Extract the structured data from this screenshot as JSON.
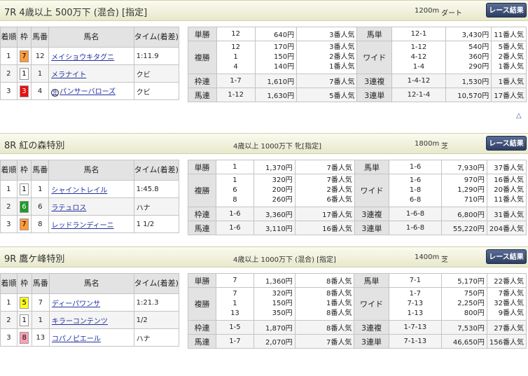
{
  "races": [
    {
      "title": "7R 4歳以上 500万下 (混合) [指定]",
      "cond": "",
      "dist": "1200m",
      "course": "ダート",
      "button": "レース結果",
      "head": {
        "rank": "着順",
        "waku": "枠",
        "uma": "馬番",
        "name": "馬名",
        "time": "タイム(着差)"
      },
      "rows": [
        {
          "rank": "1",
          "waku": "7",
          "waku_bg": "#ff9a3c",
          "waku_fg": "#000",
          "uma": "12",
          "name": "メイショウキタグニ",
          "time": "1:11.9",
          "mark": ""
        },
        {
          "rank": "2",
          "waku": "1",
          "waku_bg": "#ffffff",
          "waku_fg": "#000",
          "uma": "1",
          "name": "メラナイト",
          "time": "クビ",
          "mark": ""
        },
        {
          "rank": "3",
          "waku": "3",
          "waku_bg": "#e81010",
          "waku_fg": "#fff",
          "uma": "4",
          "name": "パンサーバローズ",
          "time": "クビ",
          "mark": "外"
        }
      ],
      "pay": {
        "tansho": {
          "label": "単勝",
          "num": "12",
          "yen": "640円",
          "pop": "3番人気"
        },
        "fukusho": {
          "label": "複勝",
          "nums": [
            "12",
            "1",
            "4"
          ],
          "yens": [
            "170円",
            "150円",
            "140円"
          ],
          "pops": [
            "3番人気",
            "2番人気",
            "1番人気"
          ]
        },
        "wakuren": {
          "label": "枠連",
          "num": "1-7",
          "yen": "1,610円",
          "pop": "7番人気"
        },
        "umaren": {
          "label": "馬連",
          "num": "1-12",
          "yen": "1,630円",
          "pop": "5番人気"
        },
        "umatan": {
          "label": "馬単",
          "num": "12-1",
          "yen": "3,430円",
          "pop": "11番人気"
        },
        "wide": {
          "label": "ワイド",
          "nums": [
            "1-12",
            "4-12",
            "1-4"
          ],
          "yens": [
            "540円",
            "360円",
            "290円"
          ],
          "pops": [
            "5番人気",
            "2番人気",
            "1番人気"
          ]
        },
        "sanfuku": {
          "label": "3連複",
          "num": "1-4-12",
          "yen": "1,530円",
          "pop": "1番人気"
        },
        "santan": {
          "label": "3連単",
          "num": "12-1-4",
          "yen": "10,570円",
          "pop": "17番人気"
        }
      }
    },
    {
      "title": "8R 紅の森特別",
      "cond": "4歳以上 1000万下 牝[指定]",
      "dist": "1800m",
      "course": "芝",
      "button": "レース結果",
      "head": {
        "rank": "着順",
        "waku": "枠",
        "uma": "馬番",
        "name": "馬名",
        "time": "タイム(着差)"
      },
      "rows": [
        {
          "rank": "1",
          "waku": "1",
          "waku_bg": "#ffffff",
          "waku_fg": "#000",
          "uma": "1",
          "name": "シャイントレイル",
          "time": "1:45.8",
          "mark": ""
        },
        {
          "rank": "2",
          "waku": "6",
          "waku_bg": "#1e9a2a",
          "waku_fg": "#fff",
          "uma": "6",
          "name": "ラテュロス",
          "time": "ハナ",
          "mark": ""
        },
        {
          "rank": "3",
          "waku": "7",
          "waku_bg": "#ff9a3c",
          "waku_fg": "#000",
          "uma": "8",
          "name": "レッドランディーニ",
          "time": "1 1/2",
          "mark": ""
        }
      ],
      "pay": {
        "tansho": {
          "label": "単勝",
          "num": "1",
          "yen": "1,370円",
          "pop": "7番人気"
        },
        "fukusho": {
          "label": "複勝",
          "nums": [
            "1",
            "6",
            "8"
          ],
          "yens": [
            "320円",
            "200円",
            "260円"
          ],
          "pops": [
            "7番人気",
            "2番人気",
            "6番人気"
          ]
        },
        "wakuren": {
          "label": "枠連",
          "num": "1-6",
          "yen": "3,360円",
          "pop": "17番人気"
        },
        "umaren": {
          "label": "馬連",
          "num": "1-6",
          "yen": "3,110円",
          "pop": "16番人気"
        },
        "umatan": {
          "label": "馬単",
          "num": "1-6",
          "yen": "7,930円",
          "pop": "37番人気"
        },
        "wide": {
          "label": "ワイド",
          "nums": [
            "1-6",
            "1-8",
            "6-8"
          ],
          "yens": [
            "970円",
            "1,290円",
            "710円"
          ],
          "pops": [
            "16番人気",
            "20番人気",
            "11番人気"
          ]
        },
        "sanfuku": {
          "label": "3連複",
          "num": "1-6-8",
          "yen": "6,800円",
          "pop": "31番人気"
        },
        "santan": {
          "label": "3連単",
          "num": "1-6-8",
          "yen": "55,220円",
          "pop": "204番人気"
        }
      }
    },
    {
      "title": "9R 鷹ケ峰特別",
      "cond": "4歳以上 1000万下 (混合) [指定]",
      "dist": "1400m",
      "course": "芝",
      "button": "レース結果",
      "head": {
        "rank": "着順",
        "waku": "枠",
        "uma": "馬番",
        "name": "馬名",
        "time": "タイム(着差)"
      },
      "rows": [
        {
          "rank": "1",
          "waku": "5",
          "waku_bg": "#ffff20",
          "waku_fg": "#000",
          "uma": "7",
          "name": "ディーパワンサ",
          "time": "1:21.3",
          "mark": ""
        },
        {
          "rank": "2",
          "waku": "1",
          "waku_bg": "#ffffff",
          "waku_fg": "#000",
          "uma": "1",
          "name": "キラーコンテンツ",
          "time": "1/2",
          "mark": ""
        },
        {
          "rank": "3",
          "waku": "8",
          "waku_bg": "#ffa0b4",
          "waku_fg": "#000",
          "uma": "13",
          "name": "コパノピエール",
          "time": "ハナ",
          "mark": ""
        }
      ],
      "pay": {
        "tansho": {
          "label": "単勝",
          "num": "7",
          "yen": "1,360円",
          "pop": "8番人気"
        },
        "fukusho": {
          "label": "複勝",
          "nums": [
            "7",
            "1",
            "13"
          ],
          "yens": [
            "320円",
            "150円",
            "350円"
          ],
          "pops": [
            "8番人気",
            "1番人気",
            "8番人気"
          ]
        },
        "wakuren": {
          "label": "枠連",
          "num": "1-5",
          "yen": "1,870円",
          "pop": "8番人気"
        },
        "umaren": {
          "label": "馬連",
          "num": "1-7",
          "yen": "2,070円",
          "pop": "7番人気"
        },
        "umatan": {
          "label": "馬単",
          "num": "7-1",
          "yen": "5,170円",
          "pop": "22番人気"
        },
        "wide": {
          "label": "ワイド",
          "nums": [
            "1-7",
            "7-13",
            "1-13"
          ],
          "yens": [
            "750円",
            "2,250円",
            "800円"
          ],
          "pops": [
            "7番人気",
            "32番人気",
            "9番人気"
          ]
        },
        "sanfuku": {
          "label": "3連複",
          "num": "1-7-13",
          "yen": "7,530円",
          "pop": "27番人気"
        },
        "santan": {
          "label": "3連単",
          "num": "7-1-13",
          "yen": "46,650円",
          "pop": "156番人気"
        }
      }
    }
  ],
  "top_link": "△"
}
